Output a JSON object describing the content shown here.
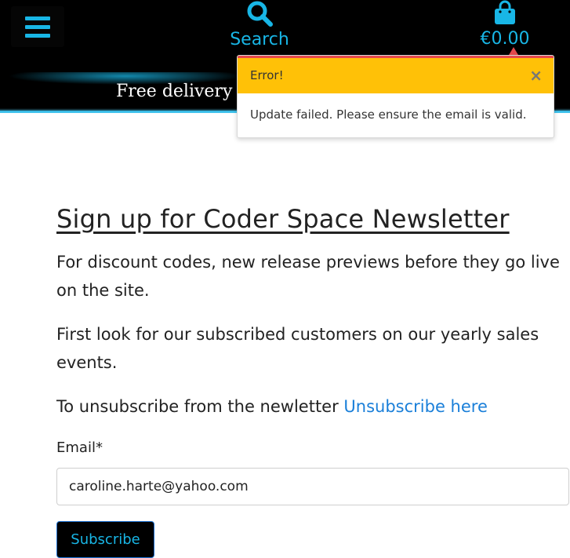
{
  "nav": {
    "search_label": "Search",
    "cart_total": "€0.00",
    "menu_icon": "hamburger-menu-icon",
    "search_icon": "search-icon",
    "cart_icon": "shopping-bag-icon",
    "accent_color": "#18b6e6"
  },
  "delivery_banner": {
    "text": "Free delivery"
  },
  "toast": {
    "title": "Error!",
    "close_symbol": "×",
    "message": "Update failed. Please ensure the email is valid.",
    "header_color": "#ffc107",
    "border_color": "#e5484d"
  },
  "newsletter": {
    "heading": "Sign up for Coder Space Newsletter",
    "paragraph_1": "For discount codes, new release previews before they go live on the site.",
    "paragraph_2": "First look for our subscribed customers on our yearly sales events.",
    "paragraph_3_prefix": "To unsubscribe from the newletter ",
    "unsubscribe_link": "Unsubscribe here",
    "email_label": "Email*",
    "email_value": "caroline.harte@yahoo.com",
    "subscribe_label": "Subscribe"
  }
}
